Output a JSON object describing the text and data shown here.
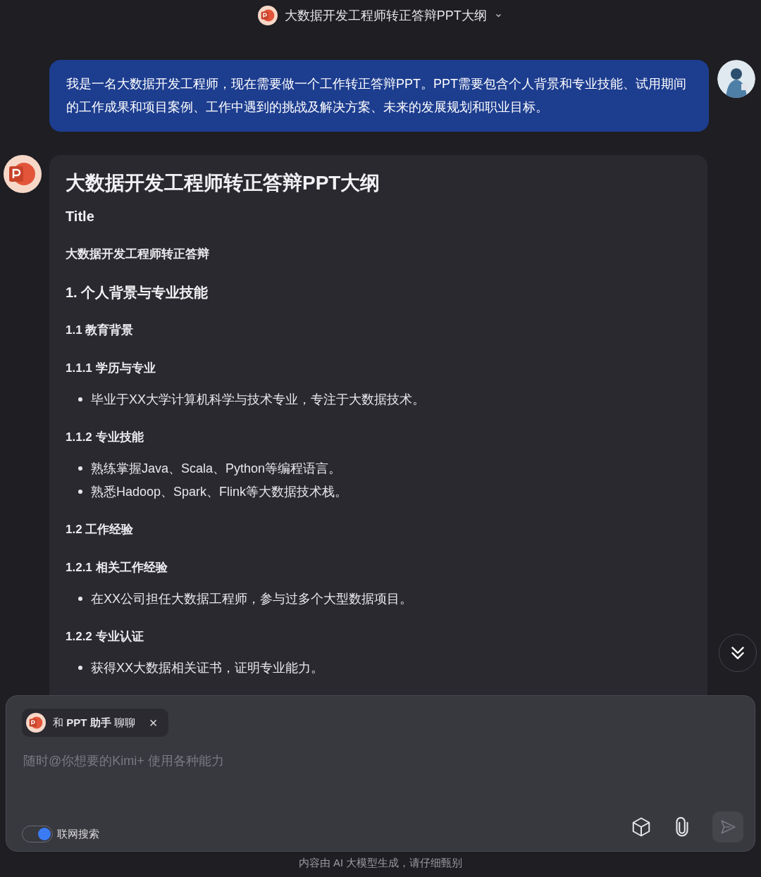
{
  "header": {
    "title": "大数据开发工程师转正答辩PPT大纲",
    "dropdown": "⌄"
  },
  "user_message": {
    "text": "我是一名大数据开发工程师，现在需要做一个工作转正答辩PPT。PPT需要包含个人背景和专业技能、试用期间的工作成果和项目案例、工作中遇到的挑战及解决方案、未来的发展规划和职业目标。"
  },
  "reply": {
    "blocks": [
      {
        "kind": "h1",
        "text": "大数据开发工程师转正答辩PPT大纲"
      },
      {
        "kind": "h2",
        "text": "Title"
      },
      {
        "kind": "h4",
        "text": "大数据开发工程师转正答辩"
      },
      {
        "kind": "h2",
        "text": "1. 个人背景与专业技能"
      },
      {
        "kind": "h4",
        "text": "1.1 教育背景"
      },
      {
        "kind": "h4",
        "text": "1.1.1 学历与专业"
      },
      {
        "kind": "bullets",
        "items": [
          "毕业于XX大学计算机科学与技术专业，专注于大数据技术。"
        ]
      },
      {
        "kind": "h4",
        "text": "1.1.2 专业技能"
      },
      {
        "kind": "bullets",
        "items": [
          "熟练掌握Java、Scala、Python等编程语言。",
          "熟悉Hadoop、Spark、Flink等大数据技术栈。"
        ]
      },
      {
        "kind": "h4",
        "text": "1.2 工作经验"
      },
      {
        "kind": "h4",
        "text": "1.2.1 相关工作经验"
      },
      {
        "kind": "bullets",
        "items": [
          "在XX公司担任大数据工程师，参与过多个大型数据项目。"
        ]
      },
      {
        "kind": "h4",
        "text": "1.2.2 专业认证"
      },
      {
        "kind": "bullets",
        "items": [
          "获得XX大数据相关证书，证明专业能力。"
        ]
      }
    ]
  },
  "composer": {
    "assistant_chip": {
      "prefix": "和 ",
      "name": "PPT 助手",
      "suffix": " 聊聊",
      "close": "×"
    },
    "placeholder": "随时@你想要的Kimi+ 使用各种能力",
    "web_search": {
      "label": "联网搜索",
      "on": true
    },
    "send_disabled": true
  },
  "footer": {
    "disclaimer": "内容由 AI 大模型生成，请仔细甄别"
  }
}
